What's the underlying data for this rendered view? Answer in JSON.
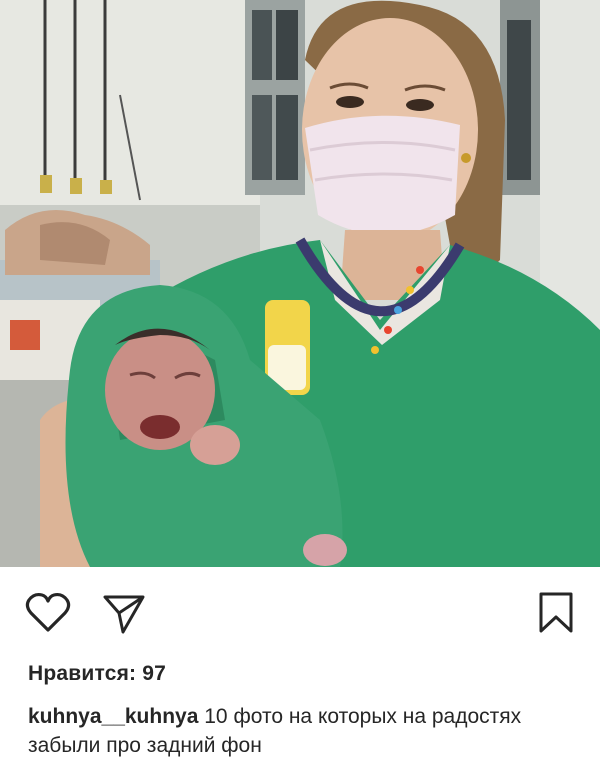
{
  "post": {
    "image_icon": "photo-nurse-with-newborn",
    "like_icon": "heart-outline-icon",
    "share_icon": "paper-plane-icon",
    "save_icon": "bookmark-outline-icon",
    "likes_text": "Нравится: 97",
    "caption_user": "kuhnya__kuhnya",
    "caption_text": "10 фото на которых на радостях забыли про задний фон"
  },
  "colors": {
    "scrubs": "#2f9e6a",
    "text": "#262626",
    "background": "#ffffff"
  }
}
